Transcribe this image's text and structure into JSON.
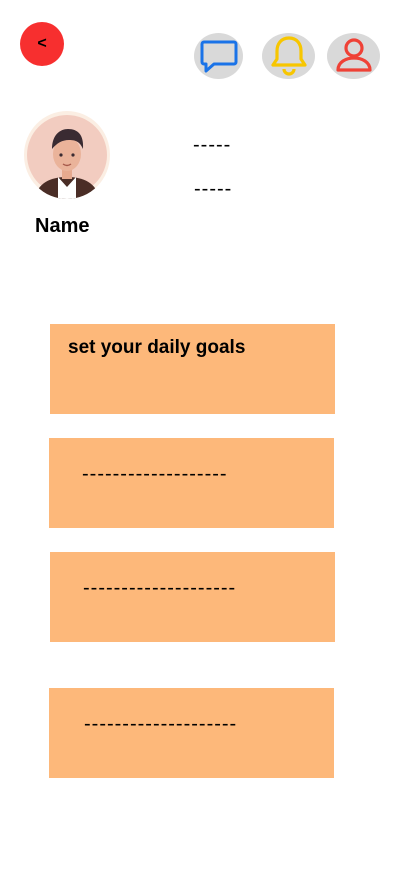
{
  "header": {
    "back_label": "<",
    "icons": [
      "chat-icon",
      "bell-icon",
      "profile-icon"
    ]
  },
  "profile": {
    "name": "Name",
    "stat_1": "-----",
    "stat_2": "-----"
  },
  "cards": [
    {
      "text": "set your daily goals"
    },
    {
      "text": "-------------------"
    },
    {
      "text": "--------------------"
    },
    {
      "text": "--------------------"
    }
  ],
  "colors": {
    "accent_red": "#f72f2f",
    "card_bg": "#fdb87a",
    "chat_blue": "#1a73e8",
    "bell_yellow": "#f7c600",
    "profile_red": "#ef4136",
    "icon_bg": "#d9d9d9"
  }
}
